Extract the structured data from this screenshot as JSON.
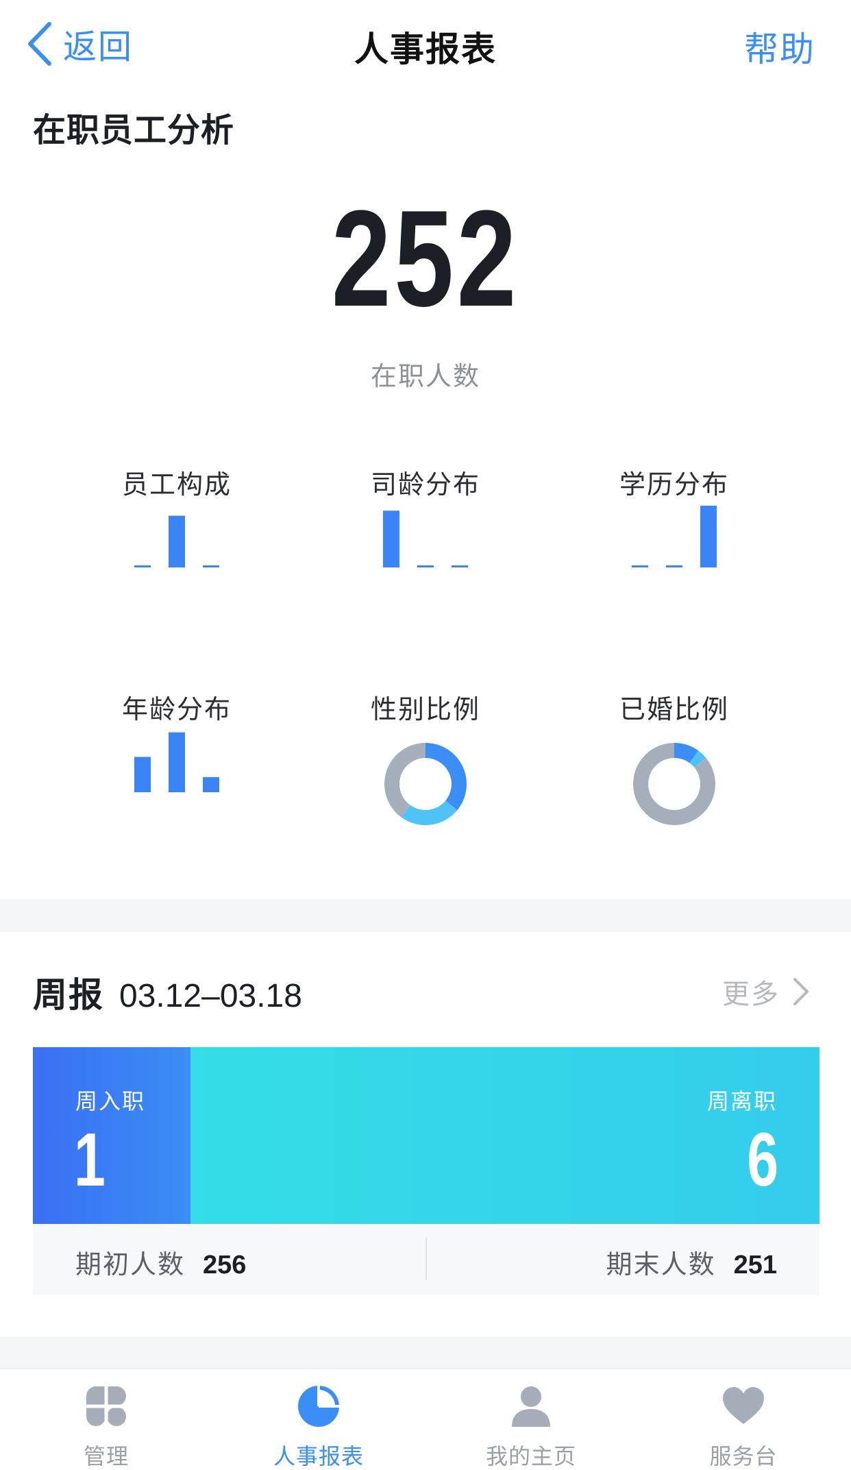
{
  "nav": {
    "back_label": "返回",
    "title": "人事报表",
    "help_label": "帮助"
  },
  "section": {
    "title": "在职员工分析"
  },
  "headcount": {
    "value": "252",
    "label": "在职人数"
  },
  "mini_charts": [
    {
      "label": "员工构成",
      "type": "bar",
      "values": [
        1,
        82,
        3
      ],
      "max": 100,
      "icon": "bar-chart-icon"
    },
    {
      "label": "司龄分布",
      "type": "bar",
      "values": [
        90,
        1,
        1
      ],
      "max": 100,
      "icon": "bar-chart-icon"
    },
    {
      "label": "学历分布",
      "type": "bar",
      "values": [
        1,
        1,
        98
      ],
      "max": 100,
      "icon": "bar-chart-icon"
    },
    {
      "label": "年龄分布",
      "type": "bar",
      "values": [
        56,
        95,
        24
      ],
      "max": 100,
      "icon": "bar-chart-icon"
    },
    {
      "label": "性别比例",
      "type": "donut",
      "slices": [
        0.36,
        0.24,
        0.4
      ],
      "icon": "donut-chart-icon"
    },
    {
      "label": "已婚比例",
      "type": "donut",
      "slices": [
        0.1,
        0.04,
        0.86
      ],
      "icon": "donut-chart-icon"
    }
  ],
  "colors": {
    "accent": "#3a8ef5",
    "bar": "#3a84f6",
    "donut": [
      "#3a8ef5",
      "#4fc3f7",
      "#a5afbb"
    ],
    "join": "#3a6ff3",
    "leave": "#34d6ea"
  },
  "weekly": {
    "title": "周报",
    "range": "03.12–03.18",
    "more_label": "更多",
    "join_label": "周入职",
    "join_value": "1",
    "leave_label": "周离职",
    "leave_value": "6",
    "start_label": "期初人数",
    "start_value": "256",
    "end_label": "期末人数",
    "end_value": "251"
  },
  "tabs": [
    {
      "label": "管理",
      "icon": "grid-clover-icon",
      "active": false
    },
    {
      "label": "人事报表",
      "icon": "pie-chart-icon",
      "active": true
    },
    {
      "label": "我的主页",
      "icon": "person-icon",
      "active": false
    },
    {
      "label": "服务台",
      "icon": "heart-icon",
      "active": false
    }
  ]
}
